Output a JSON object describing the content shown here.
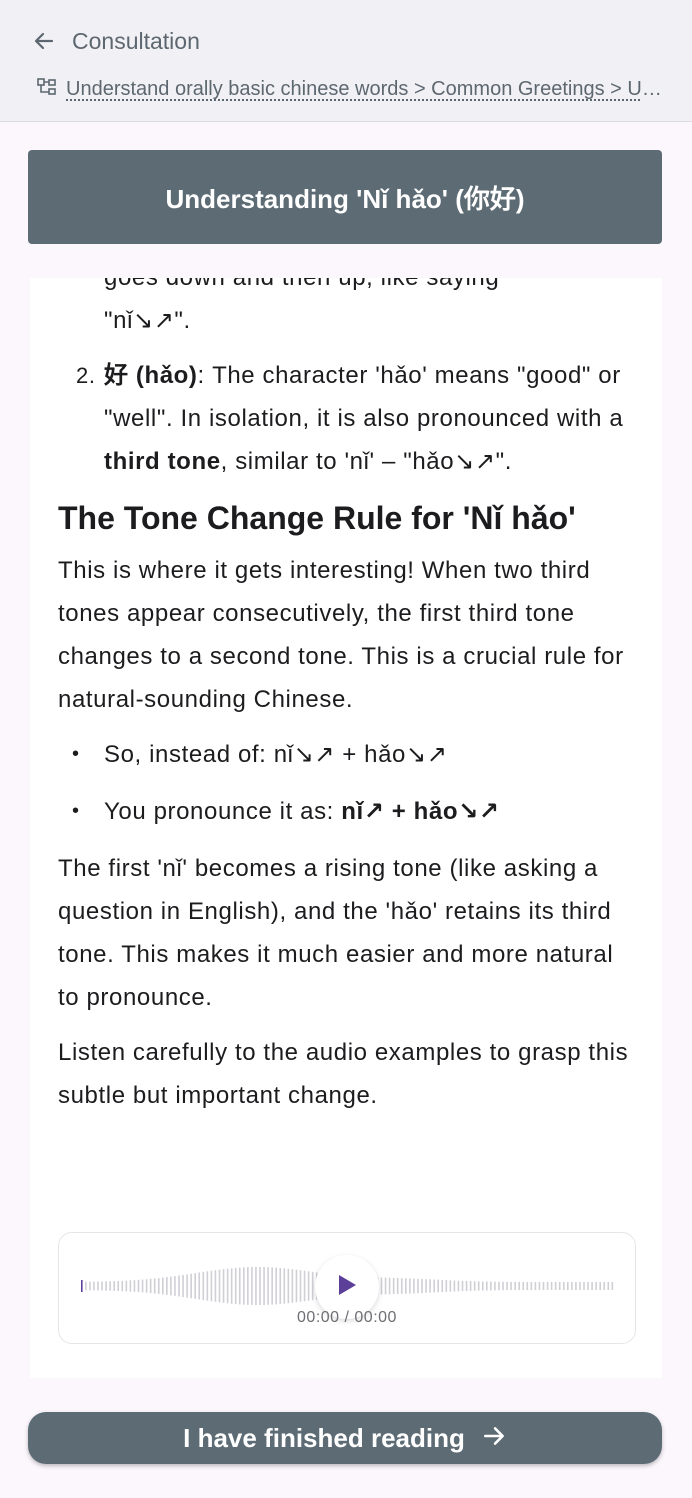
{
  "header": {
    "title": "Consultation",
    "breadcrumb": "Understand orally basic chinese words > Common Greetings > Understanding 'Nǐ hǎo' (你好)",
    "back_icon": "arrow-left-icon",
    "breadcrumb_icon": "tree-icon"
  },
  "lesson": {
    "title": "Understanding 'Nǐ hǎo' (你好)"
  },
  "content": {
    "item1_tail_line": "goes down and then up, like saying",
    "item1_tail_end": "\"nǐ↘↗\".",
    "item2": {
      "number": "2.",
      "term": "好 (hǎo)",
      "text_a": ": The character 'hǎo' means \"good\" or \"well\". In isolation, it is also pronounced with a ",
      "bold": "third tone",
      "text_b": ", similar to 'nǐ' – \"hǎo↘↗\"."
    },
    "heading": "The Tone Change Rule for 'Nǐ hǎo'",
    "para1": "This is where it gets interesting! When two third tones appear consecutively, the first third tone changes to a second tone. This is a crucial rule for natural-sounding Chinese.",
    "bullet1": "So, instead of: nǐ↘↗ + hǎo↘↗",
    "bullet2_prefix": "You pronounce it as: ",
    "bullet2_bold": "nǐ↗ + hǎo↘↗",
    "para2": "The first 'nǐ' becomes a rising tone (like asking a question in English), and the 'hǎo' retains its third tone. This makes it much easier and more natural to pronounce.",
    "para3": "Listen carefully to the audio examples to grasp this subtle but important change."
  },
  "audio": {
    "time": "00:00 / 00:00",
    "progress": 0,
    "play_icon": "play-icon"
  },
  "footer": {
    "finish_label": "I have finished reading",
    "finish_icon": "arrow-right-icon"
  },
  "colors": {
    "primary": "#5c6b74",
    "accent": "#5b3f99",
    "background": "#fbf7fd"
  }
}
